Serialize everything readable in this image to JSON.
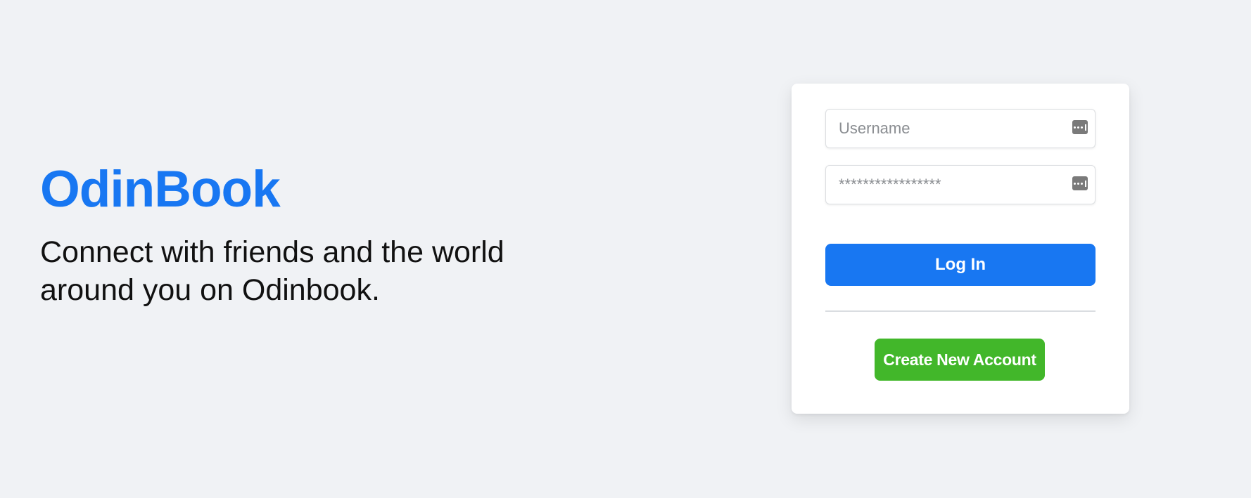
{
  "brand": {
    "title": "OdinBook",
    "tagline": "Connect with friends and the world around you on Odinbook."
  },
  "login_form": {
    "username": {
      "value": "",
      "placeholder": "Username",
      "icon": "password-manager-key-icon"
    },
    "password": {
      "value": "",
      "placeholder": "*****************",
      "icon": "password-manager-key-icon"
    },
    "login_label": "Log In",
    "create_account_label": "Create New Account"
  },
  "colors": {
    "background": "#f0f2f5",
    "brand_blue": "#1877f2",
    "create_green": "#42b72a",
    "card": "#ffffff"
  }
}
